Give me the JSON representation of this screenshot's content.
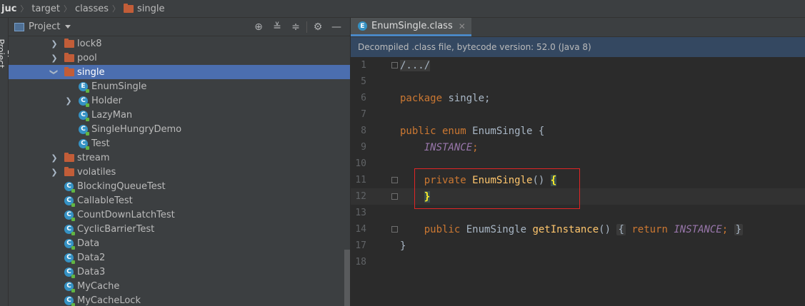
{
  "breadcrumb": {
    "items": [
      "juc",
      "target",
      "classes",
      "single"
    ]
  },
  "tool_strip": {
    "label": "1: Project"
  },
  "project_panel": {
    "title": "Project",
    "tree": [
      {
        "label": "lock8",
        "type": "folder",
        "expanded": false,
        "level": 1
      },
      {
        "label": "pool",
        "type": "folder",
        "expanded": false,
        "level": 1
      },
      {
        "label": "single",
        "type": "folder",
        "expanded": true,
        "level": 1,
        "selected": true
      },
      {
        "label": "EnumSingle",
        "type": "enum",
        "level": 2
      },
      {
        "label": "Holder",
        "type": "class",
        "level": 2,
        "expandable": true
      },
      {
        "label": "LazyMan",
        "type": "class",
        "level": 2
      },
      {
        "label": "SingleHungryDemo",
        "type": "class",
        "level": 2
      },
      {
        "label": "Test",
        "type": "class",
        "level": 2
      },
      {
        "label": "stream",
        "type": "folder",
        "expanded": false,
        "level": 1
      },
      {
        "label": "volatiles",
        "type": "folder",
        "expanded": false,
        "level": 1
      },
      {
        "label": "BlockingQueueTest",
        "type": "class",
        "level": 1
      },
      {
        "label": "CallableTest",
        "type": "class",
        "level": 1
      },
      {
        "label": "CountDownLatchTest",
        "type": "class",
        "level": 1
      },
      {
        "label": "CyclicBarrierTest",
        "type": "class",
        "level": 1
      },
      {
        "label": "Data",
        "type": "class",
        "level": 1
      },
      {
        "label": "Data2",
        "type": "class",
        "level": 1
      },
      {
        "label": "Data3",
        "type": "class",
        "level": 1
      },
      {
        "label": "MyCache",
        "type": "class",
        "level": 1
      },
      {
        "label": "MyCacheLock",
        "type": "class",
        "level": 1
      }
    ]
  },
  "editor": {
    "tab_label": "EnumSingle.class",
    "info_bar": "Decompiled .class file, bytecode version: 52.0 (Java 8)",
    "line_numbers": [
      "1",
      "5",
      "6",
      "7",
      "8",
      "9",
      "10",
      "11",
      "12",
      "13",
      "14",
      "17",
      "18"
    ],
    "code": {
      "l1": "/.../",
      "l6_kw": "package",
      "l6_rest": " single;",
      "l8_kw": "public enum",
      "l8_rest": " EnumSingle {",
      "l9_const": "INSTANCE",
      "l9_semi": ";",
      "l11_kw": "private",
      "l11_fn": "EnumSingle",
      "l11_parens": "() ",
      "l11_brace": "{",
      "l12_brace": "}",
      "l14_kw": "public",
      "l14_type": " EnumSingle ",
      "l14_fn": "getInstance",
      "l14_parens": "()",
      "l14_open": "{",
      "l14_return": "return",
      "l14_const": "INSTANCE",
      "l14_semi": ";",
      "l14_close": "}",
      "l17": "}"
    }
  },
  "colors": {
    "keyword": "#cc7832",
    "constant": "#9876aa",
    "function": "#ffc66d",
    "selection": "#4b6eaf",
    "highlight_box": "#e02525"
  }
}
